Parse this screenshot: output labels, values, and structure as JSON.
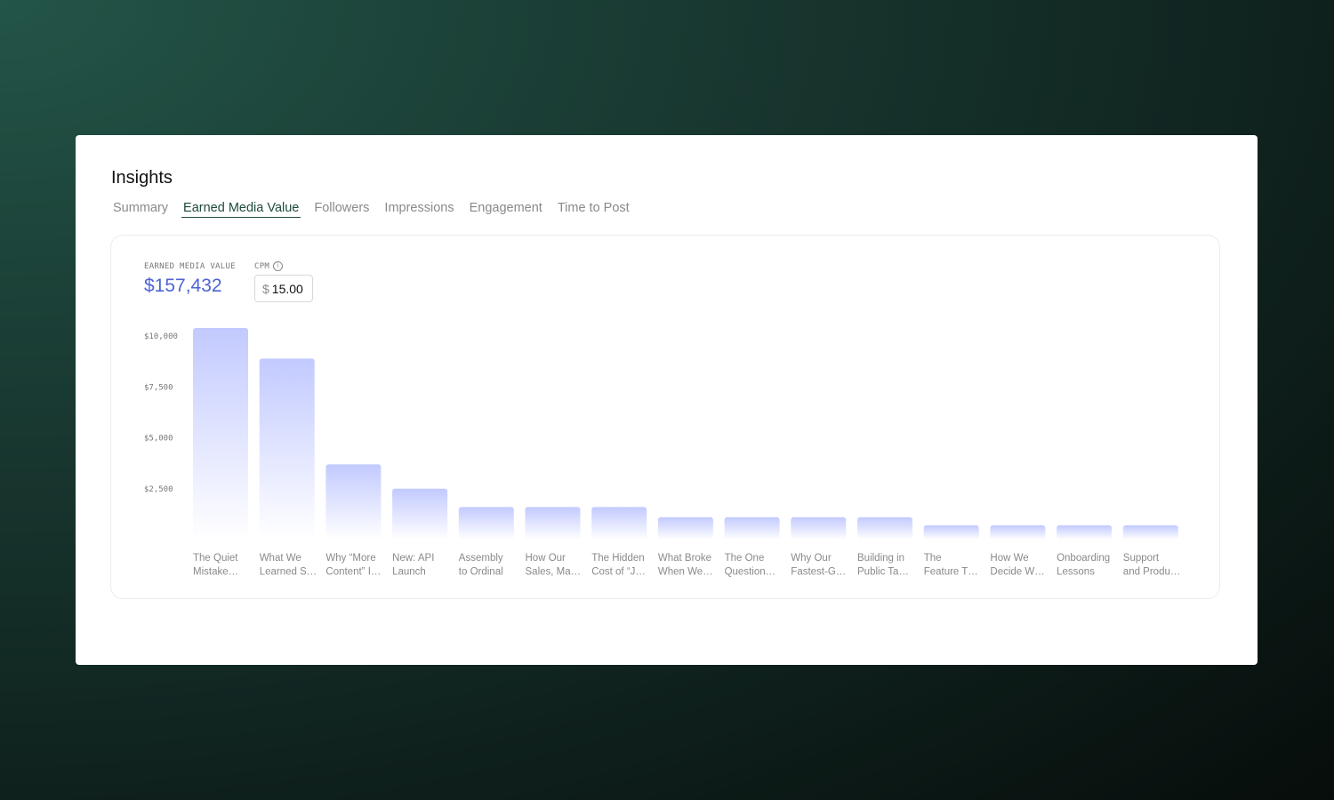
{
  "page": {
    "title": "Insights"
  },
  "tabs": [
    {
      "label": "Summary",
      "active": false
    },
    {
      "label": "Earned Media Value",
      "active": true
    },
    {
      "label": "Followers",
      "active": false
    },
    {
      "label": "Impressions",
      "active": false
    },
    {
      "label": "Engagement",
      "active": false
    },
    {
      "label": "Time to Post",
      "active": false
    }
  ],
  "emv": {
    "label": "EARNED MEDIA VALUE",
    "value": "$157,432"
  },
  "cpm": {
    "label": "CPM",
    "icon": "info-icon",
    "prefix": "$",
    "value": "15.00"
  },
  "colors": {
    "accent": "#4d63d6",
    "active_tab": "#1f4a3d",
    "bar_top": "#c2caff",
    "bar_bottom": "#ffffff"
  },
  "chart_data": {
    "type": "bar",
    "title": "",
    "xlabel": "",
    "ylabel": "",
    "ylim": [
      0,
      10400
    ],
    "yticks": [
      {
        "value": 2500,
        "label": "$2,500"
      },
      {
        "value": 5000,
        "label": "$5,000"
      },
      {
        "value": 7500,
        "label": "$7,500"
      },
      {
        "value": 10000,
        "label": "$10,000"
      }
    ],
    "grid": false,
    "categories": [
      [
        "The Quiet",
        "Mistake…"
      ],
      [
        "What We",
        "Learned S…"
      ],
      [
        "Why “More",
        "Content” I…"
      ],
      [
        "New: API",
        "Launch"
      ],
      [
        "Assembly",
        "to Ordinal"
      ],
      [
        "How Our",
        "Sales, Ma…"
      ],
      [
        "The Hidden",
        "Cost of “J…"
      ],
      [
        "What Broke",
        "When We…"
      ],
      [
        "The One",
        "Question…"
      ],
      [
        "Why Our",
        "Fastest-G…"
      ],
      [
        "Building in",
        "Public Ta…"
      ],
      [
        "The",
        "Feature T…"
      ],
      [
        "How We",
        "Decide W…"
      ],
      [
        "Onboarding",
        "Lessons"
      ],
      [
        "Support",
        "and Produ…"
      ]
    ],
    "values": [
      10400,
      8900,
      3700,
      2500,
      1600,
      1600,
      1600,
      1100,
      1100,
      1100,
      1100,
      700,
      700,
      700,
      700
    ]
  }
}
